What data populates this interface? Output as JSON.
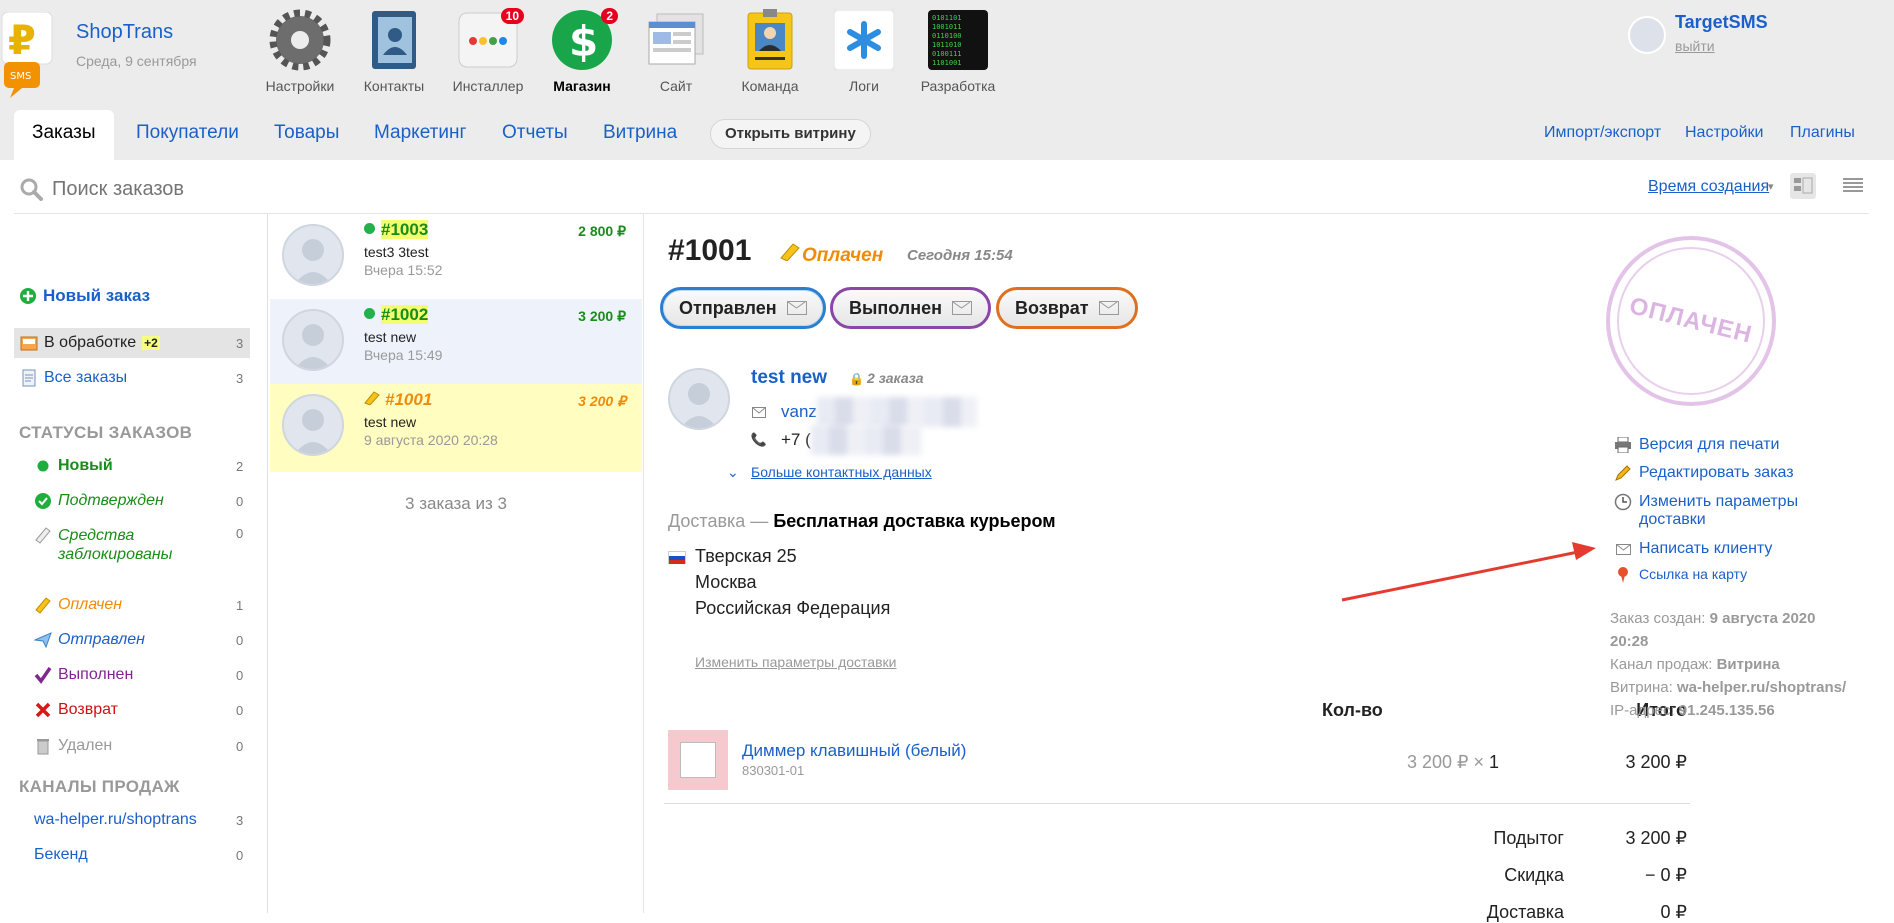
{
  "app": {
    "name": "ShopTrans",
    "date": "Среда, 9 сентября"
  },
  "apps": [
    {
      "label": "Настройки",
      "icon": "gear-icon"
    },
    {
      "label": "Контакты",
      "icon": "contacts-book-icon"
    },
    {
      "label": "Инсталлер",
      "icon": "installer-icon",
      "badge": "10"
    },
    {
      "label": "Магазин",
      "icon": "shop-dollar-icon",
      "badge": "2",
      "active": true
    },
    {
      "label": "Сайт",
      "icon": "site-icon"
    },
    {
      "label": "Команда",
      "icon": "team-badge-icon"
    },
    {
      "label": "Логи",
      "icon": "logs-asterisk-icon"
    },
    {
      "label": "Разработка",
      "icon": "dev-matrix-icon"
    }
  ],
  "user": {
    "name": "TargetSMS",
    "logout": "выйти"
  },
  "nav": {
    "tabs": [
      "Заказы",
      "Покупатели",
      "Товары",
      "Маркетинг",
      "Отчеты",
      "Витрина"
    ],
    "open_storefront": "Открыть витрину",
    "right": [
      "Импорт/экспорт",
      "Настройки",
      "Плагины"
    ]
  },
  "search": {
    "placeholder": "Поиск заказов",
    "sort_label": "Время создания",
    "sort_arrow": "▾"
  },
  "sidebar": {
    "new_order": "Новый заказ",
    "processing": {
      "label": "В обработке",
      "badge": "+2",
      "count": "3"
    },
    "all_orders": {
      "label": "Все заказы",
      "count": "3"
    },
    "statuses_header": "СТАТУСЫ ЗАКАЗОВ",
    "statuses": [
      {
        "label": "Новый",
        "count": "2",
        "color": "#1a8c1a"
      },
      {
        "label": "Подтвержден",
        "count": "0",
        "color": "#1a8c1a"
      },
      {
        "label": "Средства заблокированы",
        "line1": "Средства",
        "line2": "заблокированы",
        "count": "0",
        "color": "#1a8c1a"
      },
      {
        "label": "Оплачен",
        "count": "1",
        "color": "#ef8b0a"
      },
      {
        "label": "Отправлен",
        "count": "0",
        "color": "#1a60c8"
      },
      {
        "label": "Выполнен",
        "count": "0",
        "color": "#80278f"
      },
      {
        "label": "Возврат",
        "count": "0",
        "color": "#cc1111"
      },
      {
        "label": "Удален",
        "count": "0",
        "color": "#999999"
      }
    ],
    "channels_header": "КАНАЛЫ ПРОДАЖ",
    "channels": [
      {
        "label": "wa-helper.ru/shoptrans",
        "count": "3"
      },
      {
        "label": "Бекенд",
        "count": "0"
      }
    ]
  },
  "orders": [
    {
      "number": "#1003",
      "sum": "2 800 ₽",
      "customer": "test3 3test",
      "date": "Вчера 15:52"
    },
    {
      "number": "#1002",
      "sum": "3 200 ₽",
      "customer": "test new",
      "date": "Вчера 15:49"
    },
    {
      "number": "#1001",
      "sum": "3 200 ₽",
      "customer": "test new",
      "date": "9 августа 2020 20:28"
    }
  ],
  "orders_footer": "3 заказа из 3",
  "order": {
    "number": "#1001",
    "status": "Оплачен",
    "time": "Сегодня 15:54",
    "actions": [
      "Отправлен",
      "Выполнен",
      "Возврат"
    ],
    "customer": {
      "name": "test new",
      "orders_count": "2 заказа",
      "email": "vanz",
      "phone": "+7 (",
      "more": "Больше контактных данных"
    },
    "delivery_label": "Доставка —",
    "delivery_method": "Бесплатная доставка курьером",
    "address": [
      "Тверская 25",
      "Москва",
      "Российская Федерация"
    ],
    "change_delivery": "Изменить параметры доставки",
    "qty_header": "Кол-во",
    "total_header": "Итого",
    "item": {
      "name": "Диммер клавишный (белый)",
      "sku": "830301-01",
      "price": "3 200 ₽ ×",
      "qty": "1",
      "total": "3 200 ₽"
    },
    "summary": [
      {
        "label": "Подытог",
        "value": "3 200 ₽"
      },
      {
        "label": "Скидка",
        "value": "− 0 ₽"
      },
      {
        "label": "Доставка",
        "value": "0 ₽"
      }
    ],
    "stamp": "ОПЛАЧЕН",
    "links": [
      "Версия для печати",
      "Редактировать заказ",
      "Изменить параметры доставки",
      "Написать клиенту",
      "Ссылка на карту"
    ],
    "links_delivery_line1": "Изменить параметры",
    "links_delivery_line2": "доставки",
    "meta": {
      "created_label": "Заказ создан:",
      "created_value": "9 августа 2020 20:28",
      "created_value_1": "9 августа 2020",
      "created_value_2": "20:28",
      "channel_label": "Канал продаж:",
      "channel_value": "Витрина",
      "store_label": "Витрина:",
      "store_value": "wa-helper.ru/shoptrans/",
      "ip_label": "IP-адрес:",
      "ip_value": "91.245.135.56"
    }
  },
  "colors": {
    "accent": "#1a60c8",
    "paid": "#ef8b0a",
    "sent": "#2a7fd0",
    "done": "#8a47a6",
    "refund": "#e07020",
    "annotation_arrow": "#e53a2f"
  }
}
